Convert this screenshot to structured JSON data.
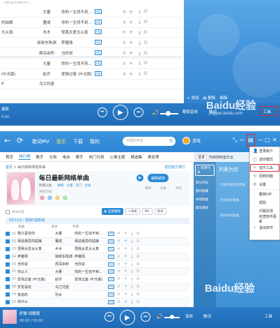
{
  "top": {
    "url_text": "...song.kuwo.cn...",
    "rows": [
      {
        "title": "",
        "artist": "大量",
        "album": "你的一生找不到...",
        "hq": true
      },
      {
        "title": "的姑娘",
        "artist": "董成",
        "album": "你的一生找不到...",
        "hq": true
      },
      {
        "title": "大从真",
        "artist": "木木",
        "album": "怪我太爱太从真",
        "hq": true
      },
      {
        "title": "",
        "artist": "徐晓东陈渊",
        "album": "养猪场",
        "hq": true
      },
      {
        "title": "",
        "artist": "周深余积",
        "album": "当你说",
        "hq": true
      },
      {
        "title": "",
        "artist": "大量",
        "album": "你的一生找不到...",
        "hq": true
      },
      {
        "title": "(叶光版)",
        "artist": "赵齐",
        "album": "爱情过客 (叶光版)",
        "hq": true
      },
      {
        "title": "ё",
        "artist": "乌兰托娅",
        "album": "",
        "hq": false
      },
      {
        "title": "",
        "artist": "",
        "album": "",
        "hq": false
      }
    ],
    "panel_toolbar": [
      "添加",
      "删除",
      "编辑",
      "重命名"
    ],
    "player": {
      "song": "最新",
      "time": "0:00",
      "lyric_label": "酷我音效",
      "bottom_buttons": [
        "音效",
        "歌词",
        "工具"
      ],
      "tool_label": "工具"
    },
    "watermark": "Baidu经验",
    "watermark_url": "jingyan.baidu.com"
  },
  "nav": {
    "tabs": [
      "歌词MV",
      "音乐",
      "下载",
      "我的"
    ],
    "active_tab": "音乐",
    "search_placeholder": "中国好声音",
    "username": "游戏",
    "controls": [
      "⤡",
      "‹›",
      "▣",
      "—",
      "□",
      "✕"
    ]
  },
  "subtabs": [
    "首页",
    "排行榜",
    "歌手",
    "分类",
    "电台",
    "歌手",
    "热门分类",
    "心情主题",
    "精选集",
    "美女秀"
  ],
  "active_subtab": "排行榜",
  "breadcrumb": {
    "home": "首页",
    "sep": " > ",
    "current": "每日最新网络单曲"
  },
  "crumb_right": "返回官方排行",
  "banner": {
    "title": "每日最新网络单曲",
    "tag_label": "所属分类：",
    "tags": [
      "网络",
      "大量",
      "热门",
      "华语"
    ],
    "intro": "开新介绍：",
    "edit_button": "编辑歌单",
    "stats": [
      "赞同",
      "分享",
      "评论"
    ]
  },
  "list": {
    "count_text": "共302首",
    "actions": [
      "全部播放",
      "+添加",
      "MV",
      "更多"
    ],
    "date_text": "3月31日 / 更新5首新歌",
    "headers": [
      "歌曲",
      "歌手",
      "专辑"
    ],
    "songs": [
      {
        "n": "01",
        "title": "我只喜欢你",
        "artist": "大量",
        "album": "你的一生找不到...",
        "checked": true
      },
      {
        "n": "02",
        "title": "保证最爱的姑娘",
        "artist": "董成",
        "album": "保证最爱的姑娘",
        "checked": true
      },
      {
        "n": "03",
        "title": "怪我太爱太从真",
        "artist": "木木",
        "album": "怪我太爱太从真",
        "checked": true
      },
      {
        "n": "04",
        "title": "养猪场",
        "artist": "徐晓东陈渊",
        "album": "养猪场",
        "checked": true
      },
      {
        "n": "05",
        "title": "当你说",
        "artist": "周深余积",
        "album": "当你说",
        "checked": true
      },
      {
        "n": "01",
        "title": "你以人",
        "artist": "大量",
        "album": "你的一生找不到...",
        "checked": true
      },
      {
        "n": "07",
        "title": "爱情过客 (叶光版)",
        "artist": "赵齐",
        "album": "爱情过客 (叶光版)",
        "checked": true
      },
      {
        "n": "08",
        "title": "岁爱喜欢",
        "artist": "乌兰托娅",
        "album": "",
        "checked": true
      },
      {
        "n": "09",
        "title": "我说的",
        "artist": "孙女",
        "album": "",
        "checked": true
      },
      {
        "n": "10",
        "title": "你什么",
        "artist": "",
        "album": "",
        "checked": true
      }
    ]
  },
  "side": {
    "top": [
      "登录",
      "开启你的音乐云"
    ],
    "left_items": [
      "+ 新建列表",
      "默认列表",
      "我的收藏",
      "本地歌曲",
      "最近播放"
    ],
    "title": "列表为空",
    "lines": [
      "浏览你喜欢的歌曲",
      "在线试听歌曲",
      "添加本地歌曲"
    ]
  },
  "menu": {
    "items": [
      {
        "icon": "👤",
        "label": "登录帐户"
      },
      {
        "icon": "◰",
        "label": "迷你模式"
      },
      {
        "icon": "✎",
        "label": "音乐工具",
        "highlight": true
      },
      {
        "icon": "⟲",
        "label": "回到旧版"
      },
      {
        "icon": "⚙",
        "label": "设置"
      },
      {
        "sep": true
      },
      {
        "icon": "",
        "label": "酷我VIP"
      },
      {
        "icon": "",
        "label": "帮助"
      },
      {
        "icon": "",
        "label": "问题反馈"
      },
      {
        "icon": "",
        "label": "检查软件更新"
      },
      {
        "icon": "✓",
        "label": "退出软件"
      }
    ]
  },
  "player": {
    "song": "好猫 而酷我",
    "time": "00:00 / 00:00",
    "buttons": [
      "音效",
      "歌词",
      "工具"
    ]
  },
  "colors": {
    "accent": "#2b8bd6",
    "bar": "#2d86d4",
    "highlight": "#d52b2b"
  }
}
